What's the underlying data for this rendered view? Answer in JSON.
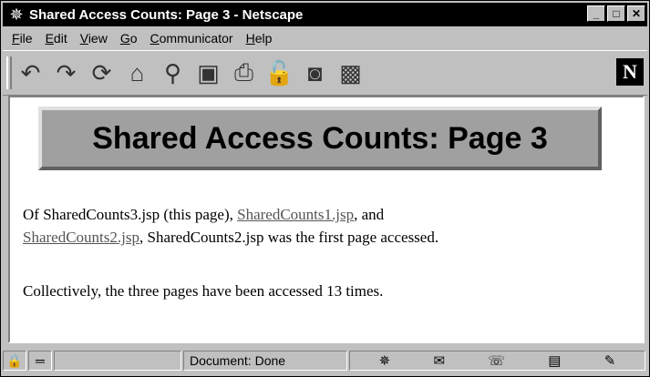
{
  "window": {
    "title": "Shared Access Counts: Page 3 - Netscape"
  },
  "menu": [
    "File",
    "Edit",
    "View",
    "Go",
    "Communicator",
    "Help"
  ],
  "toolbar": {
    "buttons": [
      {
        "name": "back-icon",
        "glyph": "↶"
      },
      {
        "name": "forward-icon",
        "glyph": "↷"
      },
      {
        "name": "reload-icon",
        "glyph": "⟳"
      },
      {
        "name": "home-icon",
        "glyph": "⌂"
      },
      {
        "name": "search-icon",
        "glyph": "⚲"
      },
      {
        "name": "my-netscape-icon",
        "glyph": "▣"
      },
      {
        "name": "print-icon",
        "glyph": "⎙"
      },
      {
        "name": "security-icon",
        "glyph": "🔓"
      },
      {
        "name": "shop-icon",
        "glyph": "◙"
      },
      {
        "name": "stop-icon",
        "glyph": "▩"
      }
    ],
    "logo": "N"
  },
  "page": {
    "heading": "Shared Access Counts: Page 3",
    "p1_a": "Of SharedCounts3.jsp (this page), ",
    "link1": "SharedCounts1.jsp",
    "p1_b": ", and",
    "link2": "SharedCounts2.jsp",
    "p1_c": ", SharedCounts2.jsp was the first page accessed.",
    "p2": "Collectively, the three pages have been accessed 13 times."
  },
  "status": {
    "text": "Document: Done"
  }
}
